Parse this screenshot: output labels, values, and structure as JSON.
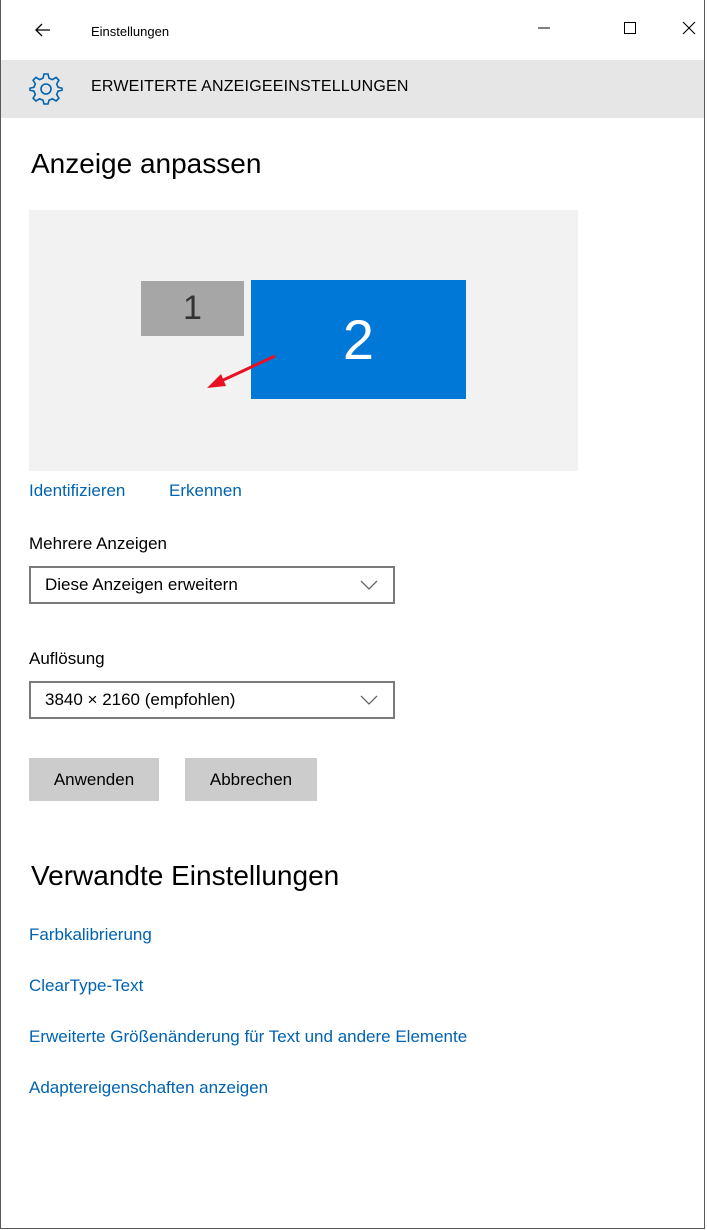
{
  "window": {
    "title": "Einstellungen",
    "controls": [
      "minimize",
      "maximize",
      "close"
    ]
  },
  "header": {
    "section": "ERWEITERTE ANZEIGEEINSTELLUNGEN",
    "icon": "gear-icon"
  },
  "main": {
    "title": "Anzeige anpassen",
    "monitors": [
      {
        "label": "1",
        "color": "#a6a6a6"
      },
      {
        "label": "2",
        "color": "#0078d7",
        "selected": true
      }
    ],
    "links": {
      "identify": "Identifizieren",
      "detect": "Erkennen"
    },
    "multiple_displays": {
      "label": "Mehrere Anzeigen",
      "value": "Diese Anzeigen erweitern"
    },
    "resolution": {
      "label": "Auflösung",
      "value": "3840 × 2160 (empfohlen)"
    },
    "buttons": {
      "apply": "Anwenden",
      "cancel": "Abbrechen"
    }
  },
  "related": {
    "title": "Verwandte Einstellungen",
    "links": [
      "Farbkalibrierung",
      "ClearType-Text",
      "Erweiterte Größenänderung für Text und andere Elemente",
      "Adaptereigenschaften anzeigen"
    ]
  },
  "colors": {
    "accent": "#0078d7",
    "link": "#0063b1",
    "header_band": "#e6e6e6",
    "annotation_arrow": "#e81123"
  }
}
